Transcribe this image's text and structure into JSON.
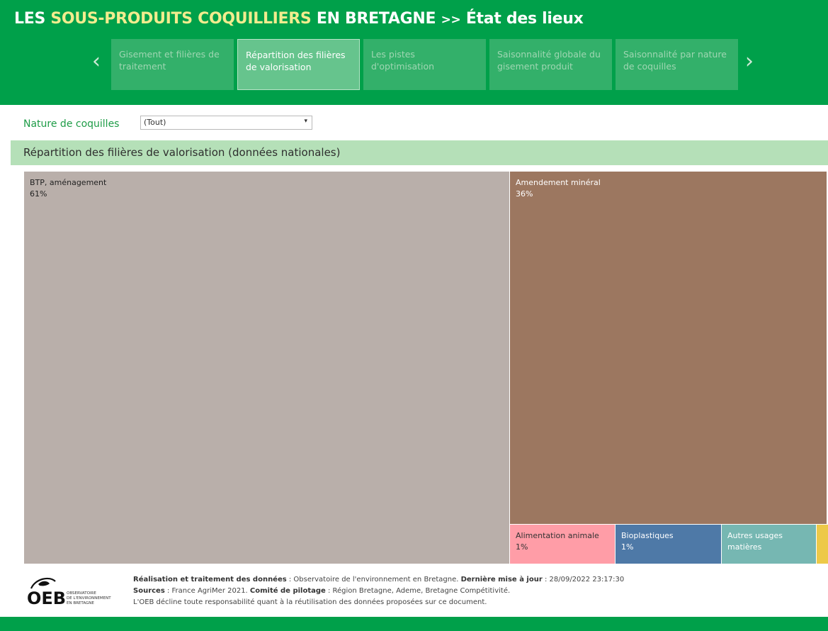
{
  "header": {
    "title_part1": "LES ",
    "title_highlight": "SOUS-PRODUITS COQUILLIERS",
    "title_part2": " EN BRETAGNE ",
    "title_sep": ">>",
    "title_part3": " État des lieux",
    "prev_glyph": "‹",
    "next_glyph": "›",
    "prev_icon": "chevron-left-icon",
    "next_icon": "chevron-right-icon"
  },
  "tabs": [
    {
      "label": "Gisement et filières de traitement",
      "active": false
    },
    {
      "label": "Répartition des filières de valorisation",
      "active": true
    },
    {
      "label": "Les pistes d'optimisation",
      "active": false
    },
    {
      "label": "Saisonnalité globale du gisement produit",
      "active": false
    },
    {
      "label": "Saisonnalité par nature de coquilles",
      "active": false
    }
  ],
  "filter": {
    "label": "Nature de coquilles",
    "value": "(Tout)",
    "caret": "▾"
  },
  "section": {
    "title": "Répartition des filières de valorisation (données nationales)"
  },
  "colors": {
    "header_green": "#00a04a",
    "title_highlight": "#f2ec8e",
    "section_bar": "#b5e0b8"
  },
  "chart_data": {
    "type": "treemap",
    "categories": [
      "BTP, aménagement",
      "Amendement minéral",
      "Alimentation animale",
      "Bioplastiques",
      "Autres usages matières",
      ""
    ],
    "values": [
      61,
      36,
      1,
      1,
      null,
      null
    ],
    "labels": [
      "61%",
      "36%",
      "1%",
      "1%",
      "",
      ""
    ],
    "colors": [
      "#b9afaa",
      "#9c7760",
      "#ff9da7",
      "#4e79a7",
      "#76b7b2",
      "#edc948"
    ]
  },
  "footer": {
    "logo_text": "OEB",
    "logo_sub1": "OBSERVATOIRE",
    "logo_sub2": "DE L'ENVIRONNEMENT",
    "logo_sub3": "EN BRETAGNE",
    "line1_b1": "Réalisation et traitement des données",
    "line1_t1": " : Observatoire de l'environnement en Bretagne. ",
    "line1_b2": "Dernière mise à jour",
    "line1_t2": " : 28/09/2022 23:17:30",
    "line2_b1": "Sources",
    "line2_t1": " : France AgriMer 2021. ",
    "line2_b2": "Comité de pilotage",
    "line2_t2": " : Région Bretagne, Ademe, Bretagne Compétitivité.",
    "line3": "L'OEB décline toute responsabilité quant à la réutilisation des données proposées sur ce document."
  }
}
